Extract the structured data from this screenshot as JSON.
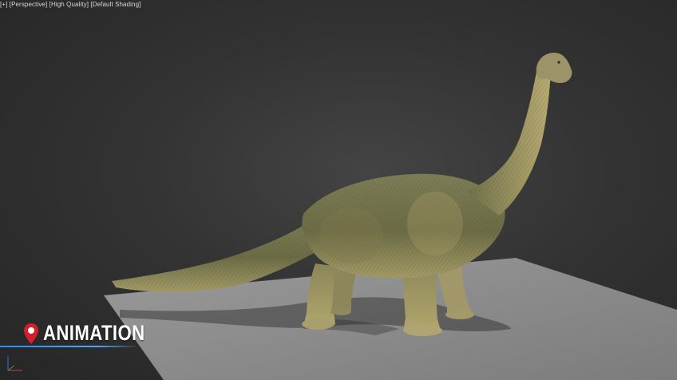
{
  "viewport": {
    "label_parts": [
      "[+]",
      "[Perspective]",
      "[High Quality]",
      "[Default Shading]"
    ],
    "label_text": "[+] [Perspective] [High Quality] [Default Shading]"
  },
  "overlay": {
    "title": "ANIMATION",
    "icon": "map-pin-icon",
    "accent_color": "#1e90ff",
    "pin_color": "#d21f2b"
  },
  "scene": {
    "subject": "brachiosaurus-model",
    "ground_color": "#8a8a8a",
    "background_color": "#333333"
  }
}
